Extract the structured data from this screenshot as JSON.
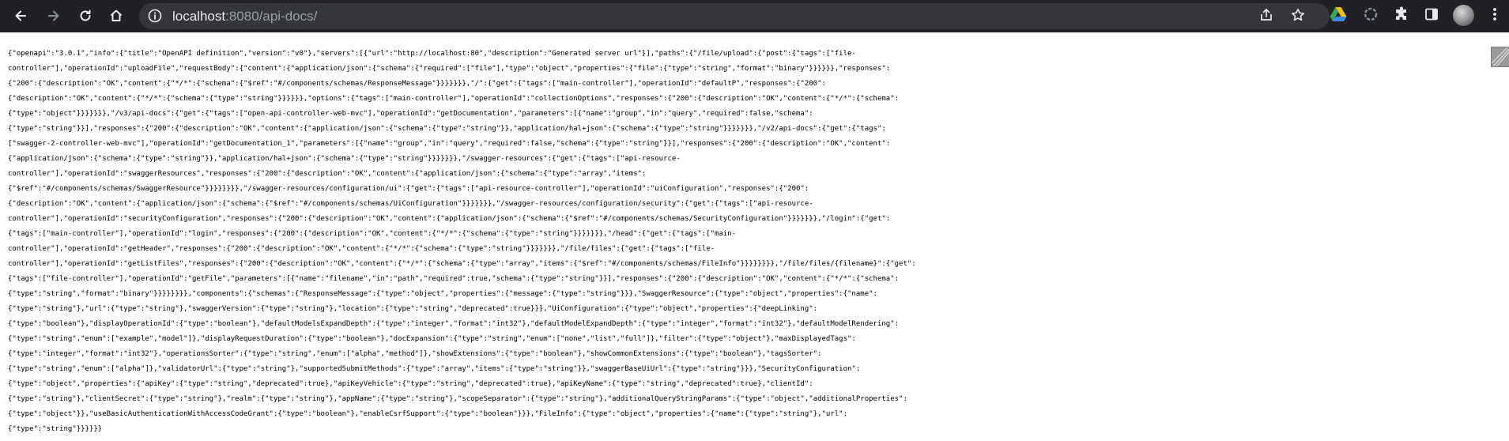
{
  "browser": {
    "url_host": "localhost",
    "url_rest": ":8080/api-docs/",
    "colors": {
      "toolbar_bg": "#202124",
      "omnibox_bg": "#35363a",
      "url_host": "#e8eaed",
      "url_dim": "#9aa0a6",
      "icon": "#e8eaed"
    },
    "icons": [
      "back-arrow-icon",
      "forward-arrow-icon",
      "reload-icon",
      "home-icon",
      "info-icon",
      "share-icon",
      "bookmark-star-icon",
      "google-drive-icon",
      "extension-icon",
      "puzzle-icon",
      "side-panel-icon",
      "menu-icon"
    ]
  },
  "page": {
    "json_lines": [
      "{\"openapi\":\"3.0.1\",\"info\":{\"title\":\"OpenAPI definition\",\"version\":\"v0\"},\"servers\":[{\"url\":\"http://localhost:80\",\"description\":\"Generated server url\"}],\"paths\":{\"/file/upload\":{\"post\":{\"tags\":[\"file-",
      "controller\"],\"operationId\":\"uploadFile\",\"requestBody\":{\"content\":{\"application/json\":{\"schema\":{\"required\":[\"file\"],\"type\":\"object\",\"properties\":{\"file\":{\"type\":\"string\",\"format\":\"binary\"}}}}}},\"responses\":",
      "{\"200\":{\"description\":\"OK\",\"content\":{\"*/*\":{\"schema\":{\"$ref\":\"#/components/schemas/ResponseMessage\"}}}}}}},\"/\":{\"get\":{\"tags\":[\"main-controller\"],\"operationId\":\"defaultP\",\"responses\":{\"200\":",
      "{\"description\":\"OK\",\"content\":{\"*/*\":{\"schema\":{\"type\":\"string\"}}}}}},\"options\":{\"tags\":[\"main-controller\"],\"operationId\":\"collectionOptions\",\"responses\":{\"200\":{\"description\":\"OK\",\"content\":{\"*/*\":{\"schema\":",
      "{\"type\":\"object\"}}}}}}},\"/v3/api-docs\":{\"get\":{\"tags\":[\"open-api-controller-web-mvc\"],\"operationId\":\"getDocumentation\",\"parameters\":[{\"name\":\"group\",\"in\":\"query\",\"required\":false,\"schema\":",
      "{\"type\":\"string\"}}],\"responses\":{\"200\":{\"description\":\"OK\",\"content\":{\"application/json\":{\"schema\":{\"type\":\"string\"}},\"application/hal+json\":{\"schema\":{\"type\":\"string\"}}}}}}},\"/v2/api-docs\":{\"get\":{\"tags\":",
      "[\"swagger-2-controller-web-mvc\"],\"operationId\":\"getDocumentation_1\",\"parameters\":[{\"name\":\"group\",\"in\":\"query\",\"required\":false,\"schema\":{\"type\":\"string\"}}],\"responses\":{\"200\":{\"description\":\"OK\",\"content\":",
      "{\"application/json\":{\"schema\":{\"type\":\"string\"}},\"application/hal+json\":{\"schema\":{\"type\":\"string\"}}}}}}},\"/swagger-resources\":{\"get\":{\"tags\":[\"api-resource-",
      "controller\"],\"operationId\":\"swaggerResources\",\"responses\":{\"200\":{\"description\":\"OK\",\"content\":{\"application/json\":{\"schema\":{\"type\":\"array\",\"items\":",
      "{\"$ref\":\"#/components/schemas/SwaggerResource\"}}}}}}}},\"/swagger-resources/configuration/ui\":{\"get\":{\"tags\":[\"api-resource-controller\"],\"operationId\":\"uiConfiguration\",\"responses\":{\"200\":",
      "{\"description\":\"OK\",\"content\":{\"application/json\":{\"schema\":{\"$ref\":\"#/components/schemas/UiConfiguration\"}}}}}}},\"/swagger-resources/configuration/security\":{\"get\":{\"tags\":[\"api-resource-",
      "controller\"],\"operationId\":\"securityConfiguration\",\"responses\":{\"200\":{\"description\":\"OK\",\"content\":{\"application/json\":{\"schema\":{\"$ref\":\"#/components/schemas/SecurityConfiguration\"}}}}}}},\"/login\":{\"get\":",
      "{\"tags\":[\"main-controller\"],\"operationId\":\"login\",\"responses\":{\"200\":{\"description\":\"OK\",\"content\":{\"*/*\":{\"schema\":{\"type\":\"string\"}}}}}}},\"/head\":{\"get\":{\"tags\":[\"main-",
      "controller\"],\"operationId\":\"getHeader\",\"responses\":{\"200\":{\"description\":\"OK\",\"content\":{\"*/*\":{\"schema\":{\"type\":\"string\"}}}}}}},\"/file/files\":{\"get\":{\"tags\":[\"file-",
      "controller\"],\"operationId\":\"getListFiles\",\"responses\":{\"200\":{\"description\":\"OK\",\"content\":{\"*/*\":{\"schema\":{\"type\":\"array\",\"items\":{\"$ref\":\"#/components/schemas/FileInfo\"}}}}}}}},\"/file/files/{filename}\":{\"get\":",
      "{\"tags\":[\"file-controller\"],\"operationId\":\"getFile\",\"parameters\":[{\"name\":\"filename\",\"in\":\"path\",\"required\":true,\"schema\":{\"type\":\"string\"}}],\"responses\":{\"200\":{\"description\":\"OK\",\"content\":{\"*/*\":{\"schema\":",
      "{\"type\":\"string\",\"format\":\"binary\"}}}}}}}},\"components\":{\"schemas\":{\"ResponseMessage\":{\"type\":\"object\",\"properties\":{\"message\":{\"type\":\"string\"}}},\"SwaggerResource\":{\"type\":\"object\",\"properties\":{\"name\":",
      "{\"type\":\"string\"},\"url\":{\"type\":\"string\"},\"swaggerVersion\":{\"type\":\"string\"},\"location\":{\"type\":\"string\",\"deprecated\":true}}},\"UiConfiguration\":{\"type\":\"object\",\"properties\":{\"deepLinking\":",
      "{\"type\":\"boolean\"},\"displayOperationId\":{\"type\":\"boolean\"},\"defaultModelsExpandDepth\":{\"type\":\"integer\",\"format\":\"int32\"},\"defaultModelExpandDepth\":{\"type\":\"integer\",\"format\":\"int32\"},\"defaultModelRendering\":",
      "{\"type\":\"string\",\"enum\":[\"example\",\"model\"]},\"displayRequestDuration\":{\"type\":\"boolean\"},\"docExpansion\":{\"type\":\"string\",\"enum\":[\"none\",\"list\",\"full\"]},\"filter\":{\"type\":\"object\"},\"maxDisplayedTags\":",
      "{\"type\":\"integer\",\"format\":\"int32\"},\"operationsSorter\":{\"type\":\"string\",\"enum\":[\"alpha\",\"method\"]},\"showExtensions\":{\"type\":\"boolean\"},\"showCommonExtensions\":{\"type\":\"boolean\"},\"tagsSorter\":",
      "{\"type\":\"string\",\"enum\":[\"alpha\"]},\"validatorUrl\":{\"type\":\"string\"},\"supportedSubmitMethods\":{\"type\":\"array\",\"items\":{\"type\":\"string\"}},\"swaggerBaseUiUrl\":{\"type\":\"string\"}}},\"SecurityConfiguration\":",
      "{\"type\":\"object\",\"properties\":{\"apiKey\":{\"type\":\"string\",\"deprecated\":true},\"apiKeyVehicle\":{\"type\":\"string\",\"deprecated\":true},\"apiKeyName\":{\"type\":\"string\",\"deprecated\":true},\"clientId\":",
      "{\"type\":\"string\"},\"clientSecret\":{\"type\":\"string\"},\"realm\":{\"type\":\"string\"},\"appName\":{\"type\":\"string\"},\"scopeSeparator\":{\"type\":\"string\"},\"additionalQueryStringParams\":{\"type\":\"object\",\"additionalProperties\":",
      "{\"type\":\"object\"}},\"useBasicAuthenticationWithAccessCodeGrant\":{\"type\":\"boolean\"},\"enableCsrfSupport\":{\"type\":\"boolean\"}}},\"FileInfo\":{\"type\":\"object\",\"properties\":{\"name\":{\"type\":\"string\"},\"url\":",
      "{\"type\":\"string\"}}}}}}"
    ]
  }
}
